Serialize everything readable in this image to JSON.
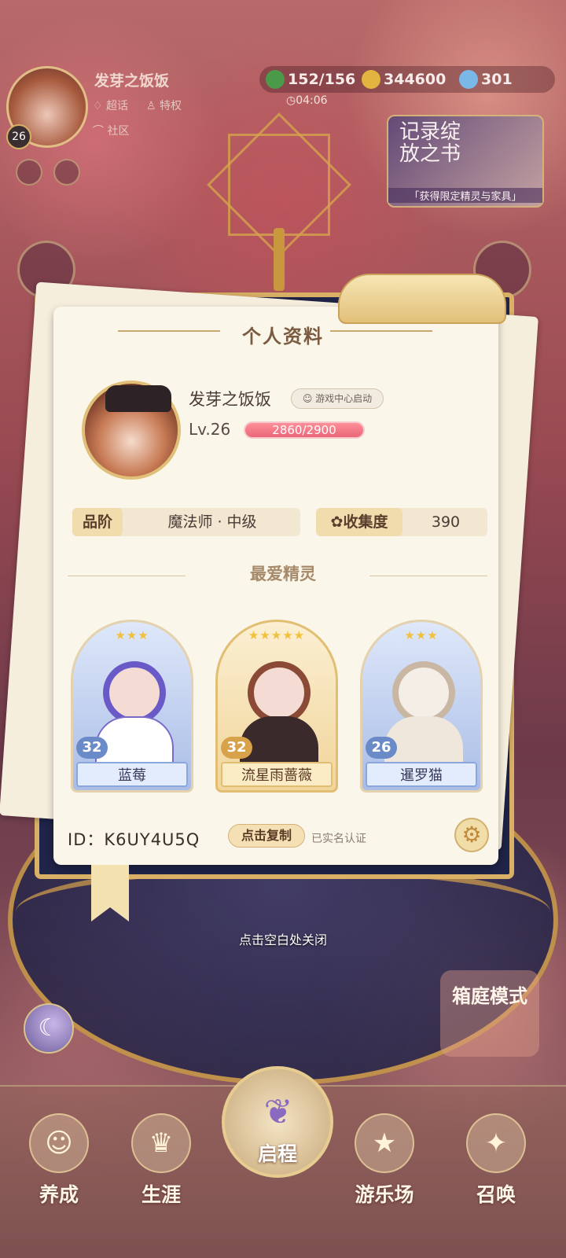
{
  "top": {
    "nickname": "发芽之饭饭",
    "level": "26",
    "links": {
      "chaohua": "超话",
      "tequan": "特权",
      "shequ": "社区"
    },
    "resources": {
      "clover": "152/156",
      "coins": "344600",
      "gems": "301"
    },
    "timer": "04:06",
    "banner": {
      "title": "记录绽放之书",
      "subtitle": "「获得限定精灵与家具」"
    }
  },
  "card": {
    "title": "个人资料",
    "name": "发芽之饭饭",
    "game_center_badge": "游戏中心启动",
    "level_label": "Lv.26",
    "xp": "2860/2900",
    "xp_fraction": 0.986,
    "rank_label": "品阶",
    "rank_value": "魔法师 · 中级",
    "collect_label": "收集度",
    "collect_value": "390",
    "favorites_title": "最爱精灵",
    "favorites": [
      {
        "name": "蓝莓",
        "level": "32",
        "stars": "★★★",
        "color": "#6a6ad0"
      },
      {
        "name": "流星雨蔷薇",
        "level": "32",
        "stars": "★★★★★",
        "color": "#8a4a36"
      },
      {
        "name": "暹罗猫",
        "level": "26",
        "stars": "★★★",
        "color": "#c9b7a4"
      }
    ],
    "id_text": "ID：K6UY4U5Q",
    "copy_button": "点击复制",
    "verified": "已实名认证"
  },
  "close_hint": "点击空白处关闭",
  "side": {
    "yard": "箱庭模式"
  },
  "nav": {
    "yangcheng": "养成",
    "shengya": "生涯",
    "qicheng": "启程",
    "youlechang": "游乐场",
    "zhaohuan": "召唤"
  },
  "colors": {
    "accent_gold": "#d9b066",
    "xp_pink": "#e9677a",
    "panel_navy": "#1f2448"
  }
}
